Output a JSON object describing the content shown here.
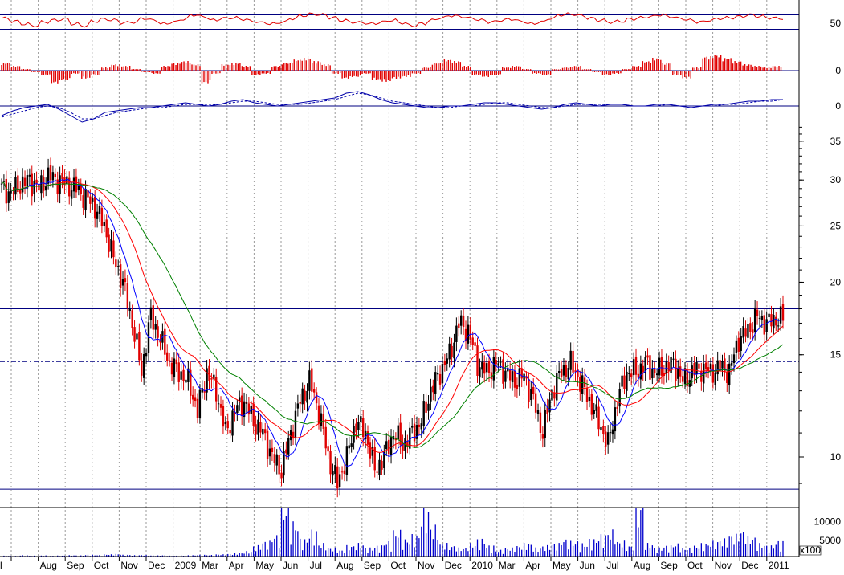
{
  "colors": {
    "candle_up": "#000000",
    "candle_down": "#e00000",
    "ma_short": "#0000ff",
    "ma_mid": "#ff0000",
    "ma_long": "#008000",
    "oscillator": "#e00000",
    "macd_line": "#0000aa",
    "volume": "#0000cc",
    "grid": "#9a9a9a",
    "level_line": "#000080"
  },
  "chart_data": [
    {
      "type": "line",
      "panel": "oscillator",
      "y_tick_labels": [
        "50"
      ],
      "ylim": [
        0,
        100
      ],
      "reference_levels": [
        70,
        30
      ],
      "series": [
        {
          "values": [
            60,
            52,
            45,
            40,
            50,
            55,
            58,
            45,
            40,
            52,
            58,
            55,
            48,
            50,
            60,
            55,
            45,
            50,
            58,
            70,
            65,
            55,
            60,
            62,
            58,
            52,
            48,
            45,
            50,
            60,
            68,
            72,
            70,
            62,
            55,
            50,
            48,
            45,
            50,
            55,
            48,
            40,
            45,
            55,
            62,
            68,
            65,
            60,
            55,
            50,
            55,
            58,
            52,
            45,
            50,
            60,
            70,
            72,
            68,
            60,
            55,
            50,
            52,
            58,
            62,
            65,
            70,
            65,
            60,
            55,
            50,
            55,
            60,
            62,
            65,
            70,
            66,
            62,
            60
          ]
        }
      ]
    },
    {
      "type": "bar",
      "panel": "momentum",
      "y_tick_labels": [
        "0"
      ],
      "ylim": [
        -1,
        1
      ],
      "series": [
        {
          "values": [
            0.5,
            0.3,
            0.1,
            -0.1,
            -0.3,
            -0.8,
            -0.6,
            -0.2,
            -0.5,
            -0.3,
            0.2,
            0.4,
            0.3,
            0.1,
            -0.1,
            -0.2,
            0.3,
            0.5,
            0.6,
            0.4,
            -0.8,
            -0.2,
            0.4,
            0.5,
            0.3,
            -0.3,
            -0.2,
            0.3,
            0.5,
            0.7,
            0.8,
            0.6,
            0.4,
            -0.2,
            -0.5,
            -0.4,
            -0.2,
            -0.6,
            -0.7,
            -0.5,
            -0.4,
            -0.2,
            0.2,
            0.5,
            0.7,
            0.6,
            0.3,
            -0.3,
            -0.4,
            -0.3,
            0.2,
            0.3,
            0.1,
            -0.2,
            -0.3,
            0.1,
            0.2,
            0.3,
            0.1,
            -0.1,
            -0.3,
            -0.2,
            0.1,
            0.3,
            0.6,
            0.8,
            0.5,
            -0.3,
            -0.5,
            0.2,
            0.9,
            1.0,
            0.8,
            0.6,
            0.4,
            0.3,
            0.2,
            0.3
          ]
        }
      ]
    },
    {
      "type": "line",
      "panel": "macd",
      "y_tick_labels": [
        "0"
      ],
      "ylim": [
        -1.5,
        1.2
      ],
      "series": [
        {
          "values": [
            -0.6,
            -0.3,
            -0.1,
            0.0,
            0.1,
            -0.2,
            -0.6,
            -1.0,
            -0.8,
            -0.4,
            -0.3,
            -0.2,
            -0.1,
            -0.1,
            0.0,
            0.1,
            0.2,
            0.1,
            0.0,
            0.1,
            0.3,
            0.4,
            0.2,
            0.1,
            0.0,
            0.1,
            0.2,
            0.3,
            0.4,
            0.5,
            0.8,
            0.9,
            0.7,
            0.4,
            0.2,
            0.1,
            0.0,
            -0.1,
            -0.1,
            0.0,
            0.0,
            0.1,
            0.2,
            0.2,
            0.1,
            0.0,
            -0.1,
            -0.2,
            -0.1,
            0.1,
            0.2,
            0.1,
            0.0,
            0.1,
            0.1,
            0.0,
            0.0,
            0.1,
            0.1,
            0.0,
            -0.1,
            0.0,
            0.1,
            0.1,
            0.2,
            0.3,
            0.3,
            0.4,
            0.4
          ]
        },
        {
          "values": [
            -0.7,
            -0.5,
            -0.3,
            -0.1,
            0.0,
            -0.1,
            -0.4,
            -0.8,
            -0.8,
            -0.6,
            -0.4,
            -0.3,
            -0.2,
            -0.1,
            -0.1,
            0.0,
            0.1,
            0.1,
            0.1,
            0.1,
            0.2,
            0.3,
            0.3,
            0.2,
            0.1,
            0.1,
            0.1,
            0.2,
            0.3,
            0.4,
            0.6,
            0.8,
            0.7,
            0.5,
            0.3,
            0.2,
            0.1,
            0.0,
            -0.1,
            -0.1,
            0.0,
            0.0,
            0.1,
            0.2,
            0.2,
            0.1,
            0.0,
            -0.1,
            -0.1,
            0.0,
            0.1,
            0.1,
            0.1,
            0.1,
            0.1,
            0.0,
            0.0,
            0.0,
            0.1,
            0.0,
            0.0,
            0.0,
            0.0,
            0.1,
            0.1,
            0.2,
            0.3,
            0.3,
            0.4
          ]
        }
      ]
    },
    {
      "type": "candlestick",
      "panel": "price",
      "y_scale": "log",
      "y_tick_labels": [
        "10",
        "15",
        "20",
        "25",
        "30",
        "35"
      ],
      "ylim": [
        8.5,
        38
      ],
      "horizontal_levels": [
        {
          "value": 18.0,
          "style": "solid"
        },
        {
          "value": 14.6,
          "style": "dashdot"
        },
        {
          "value": 8.8,
          "style": "solid"
        }
      ],
      "x_tick_labels": [
        "l",
        "Aug",
        "Sep",
        "Oct",
        "Nov",
        "Dec",
        "2009",
        "Mar",
        "Apr",
        "May",
        "Jun",
        "Jul",
        "Aug",
        "Sep",
        "Oct",
        "Nov",
        "Dec",
        "2010",
        "Mar",
        "Apr",
        "May",
        "Jun",
        "Jul",
        "Aug",
        "Sep",
        "Oct",
        "Nov",
        "Dec",
        "2011"
      ],
      "weekly_close": [
        29.0,
        28.5,
        29.5,
        30.0,
        29.0,
        30.5,
        30.0,
        29.5,
        29.0,
        28.0,
        27.0,
        25.0,
        22.0,
        20.0,
        17.0,
        14.0,
        17.5,
        16.0,
        14.5,
        14.0,
        13.5,
        12.0,
        14.0,
        13.0,
        11.0,
        12.0,
        12.5,
        11.5,
        11.0,
        10.0,
        9.5,
        11.0,
        12.5,
        13.5,
        12.0,
        10.0,
        9.0,
        10.0,
        11.5,
        11.0,
        9.5,
        10.0,
        11.0,
        10.5,
        11.0,
        11.5,
        13.0,
        14.0,
        15.0,
        17.0,
        16.5,
        14.5,
        14.0,
        14.5,
        14.0,
        13.5,
        13.8,
        12.5,
        11.0,
        13.0,
        14.0,
        14.5,
        13.5,
        12.5,
        11.5,
        10.5,
        12.5,
        14.0,
        14.0,
        14.5,
        14.0,
        14.2,
        14.5,
        13.5,
        14.0,
        14.2,
        14.0,
        14.3,
        14.0,
        16.0,
        16.5,
        17.5,
        17.0,
        17.3
      ]
    },
    {
      "type": "bar",
      "panel": "volume",
      "y_tick_labels": [
        "10000",
        "5000"
      ],
      "y_unit_label": "x100",
      "ylim": [
        0,
        14000
      ],
      "values": [
        200,
        150,
        300,
        200,
        250,
        180,
        220,
        300,
        250,
        400,
        350,
        500,
        600,
        400,
        300,
        350,
        250,
        300,
        200,
        250,
        300,
        400,
        350,
        500,
        600,
        800,
        1200,
        2500,
        3500,
        5000,
        12000,
        8000,
        4000,
        6000,
        3000,
        2000,
        1500,
        2500,
        3000,
        2000,
        2500,
        3500,
        6000,
        4000,
        5000,
        11000,
        7000,
        3000,
        2500,
        2000,
        3000,
        4000,
        2500,
        1500,
        2000,
        2500,
        3000,
        2000,
        2500,
        3000,
        4000,
        3500,
        3000,
        4000,
        5000,
        6000,
        3500,
        2500,
        12000,
        3000,
        2000,
        2500,
        3000,
        2000,
        2500,
        3000,
        3500,
        4000,
        5000,
        6000,
        4500,
        3000,
        2500,
        3500
      ]
    }
  ]
}
